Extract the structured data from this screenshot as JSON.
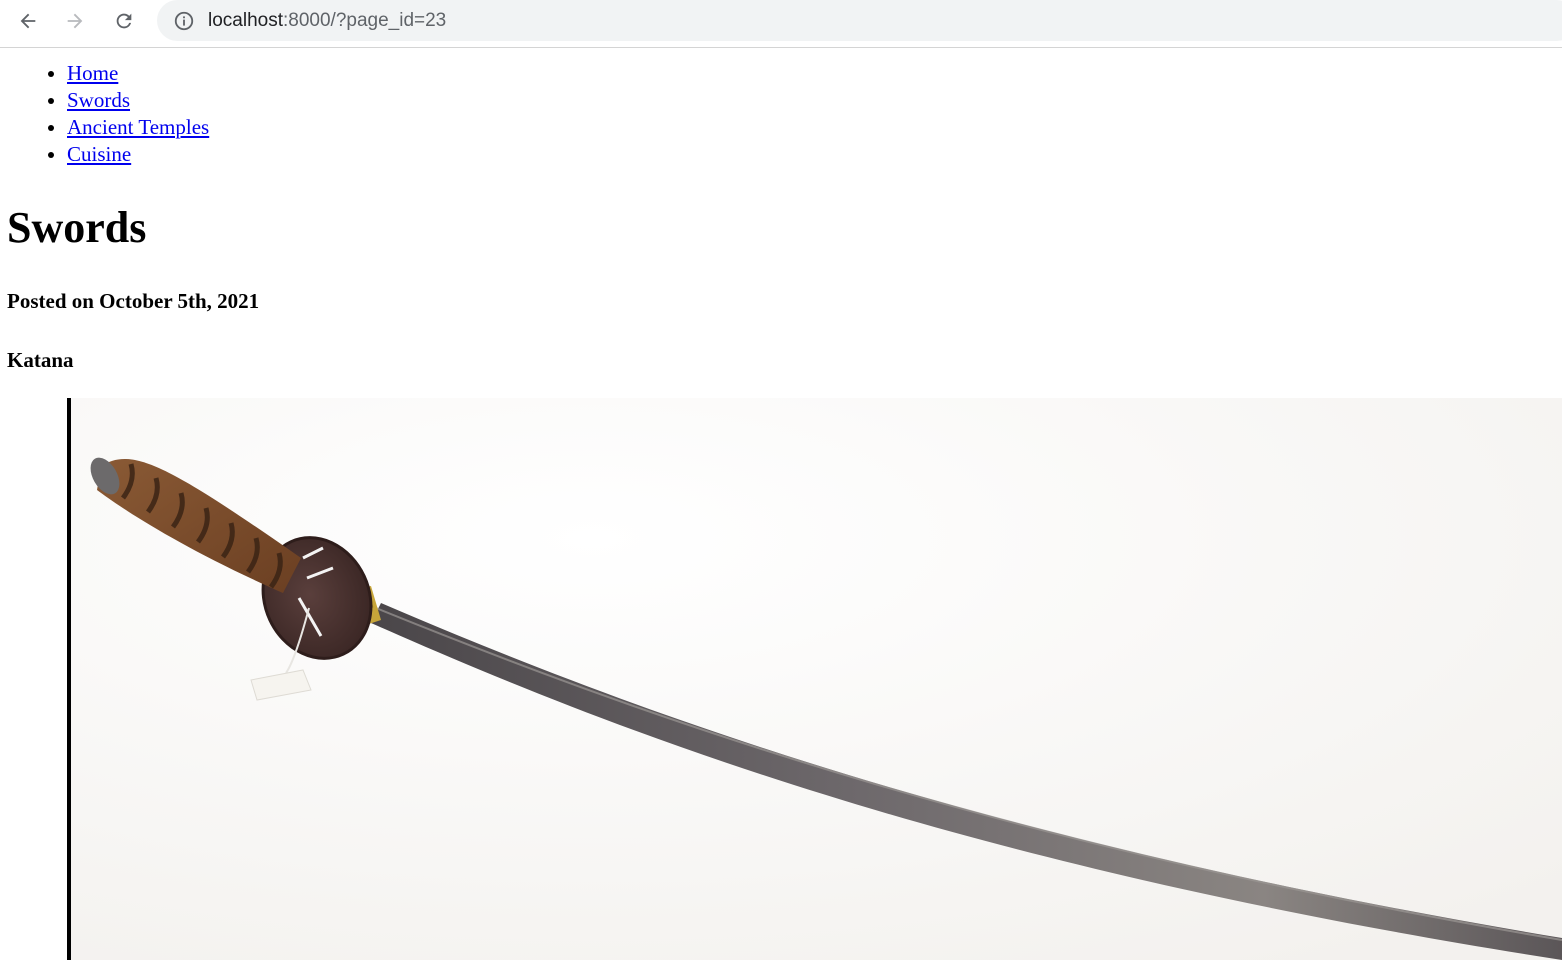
{
  "browser": {
    "url_host": "localhost",
    "url_rest": ":8000/?page_id=23"
  },
  "nav": {
    "items": [
      {
        "label": "Home"
      },
      {
        "label": "Swords"
      },
      {
        "label": "Ancient Temples"
      },
      {
        "label": "Cuisine"
      }
    ]
  },
  "post": {
    "title": "Swords",
    "posted_on": "Posted on October 5th, 2021",
    "section_heading": "Katana",
    "image_subject": "katana-image"
  },
  "colors": {
    "link": "#0000ee",
    "omnibox_bg": "#f1f3f4"
  }
}
